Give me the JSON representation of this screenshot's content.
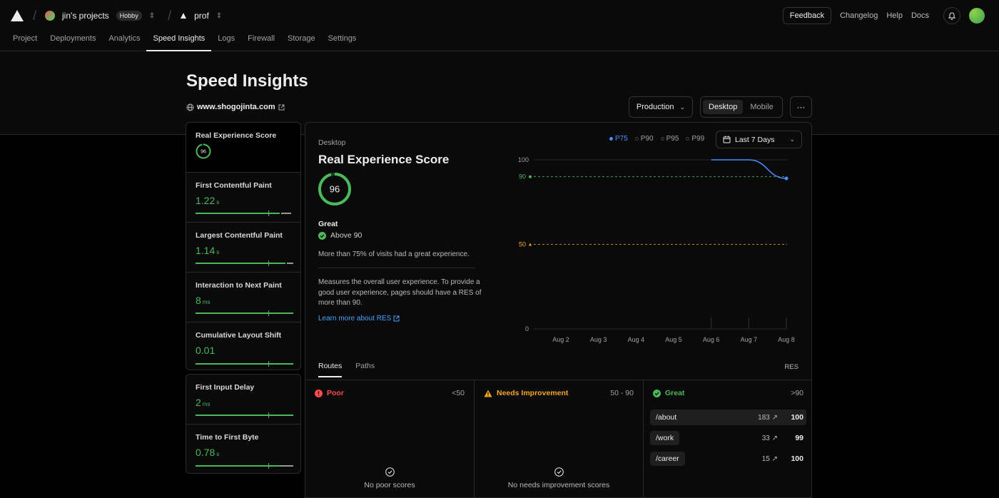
{
  "header": {
    "team_name": "jin's projects",
    "team_plan": "Hobby",
    "project_name": "prof",
    "feedback_label": "Feedback",
    "links": [
      "Changelog",
      "Help",
      "Docs"
    ]
  },
  "tabs": [
    "Project",
    "Deployments",
    "Analytics",
    "Speed Insights",
    "Logs",
    "Firewall",
    "Storage",
    "Settings"
  ],
  "active_tab": "Speed Insights",
  "page": {
    "title": "Speed Insights",
    "site": "www.shogojinta.com",
    "environment": "Production",
    "device_options": [
      "Desktop",
      "Mobile"
    ],
    "device_selected": "Desktop",
    "more_label": "···"
  },
  "metrics": [
    {
      "name": "Real Experience Score",
      "value": "96",
      "unit": ""
    },
    {
      "name": "First Contentful Paint",
      "value": "1.22",
      "unit": "s",
      "marker_fraction": 0.75
    },
    {
      "name": "Largest Contentful Paint",
      "value": "1.14",
      "unit": "s",
      "marker_fraction": 0.75
    },
    {
      "name": "Interaction to Next Paint",
      "value": "8",
      "unit": "ms",
      "marker_fraction": 0.75
    },
    {
      "name": "Cumulative Layout Shift",
      "value": "0.01",
      "unit": "",
      "marker_fraction": 0.75
    },
    {
      "name": "First Input Delay",
      "value": "2",
      "unit": "ms",
      "marker_fraction": 0.75
    },
    {
      "name": "Time to First Byte",
      "value": "0.78",
      "unit": "s",
      "marker_fraction": 0.75
    }
  ],
  "detail": {
    "device": "Desktop",
    "title": "Real Experience Score",
    "score": "96",
    "score_fraction": 0.96,
    "rating": "Great",
    "rating_rule": "Above 90",
    "visits_note": "More than 75% of visits had a great experience.",
    "description": "Measures the overall user experience. To provide a good user experience, pages should have a RES of more than 90.",
    "learn_more": "Learn more about RES",
    "percentiles": [
      "P75",
      "P90",
      "P95",
      "P99"
    ],
    "percentile_selected": "P75",
    "time_range": "Last 7 Days"
  },
  "chart_data": {
    "type": "line",
    "x": [
      "Aug 2",
      "Aug 3",
      "Aug 4",
      "Aug 5",
      "Aug 6",
      "Aug 7",
      "Aug 8"
    ],
    "series": [
      {
        "values": [
          null,
          null,
          null,
          null,
          100,
          100,
          89
        ]
      }
    ],
    "yticks": [
      "100",
      "90",
      "50",
      "0"
    ],
    "ylim": [
      0,
      100
    ],
    "thresholds": [
      {
        "value": 90,
        "label": "90",
        "color": "#4cb85c"
      },
      {
        "value": 50,
        "label": "50",
        "color": "#f5a623"
      }
    ],
    "line_color": "#4a8dff"
  },
  "routes_tabs": [
    "Routes",
    "Paths"
  ],
  "routes_tab_selected": "Routes",
  "res_label": "RES",
  "buckets": {
    "poor": {
      "label": "Poor",
      "range": "<50",
      "empty": "No poor scores",
      "color": "#ff4d4d"
    },
    "needs": {
      "label": "Needs Improvement",
      "range": "50 - 90",
      "empty": "No needs improvement scores",
      "color": "#f5a623"
    },
    "great": {
      "label": "Great",
      "range": ">90",
      "color": "#4cb85c"
    }
  },
  "great_routes": [
    {
      "route": "/about",
      "count": "183",
      "score": "100"
    },
    {
      "route": "/work",
      "count": "33",
      "score": "99"
    },
    {
      "route": "/career",
      "count": "15",
      "score": "100"
    }
  ]
}
